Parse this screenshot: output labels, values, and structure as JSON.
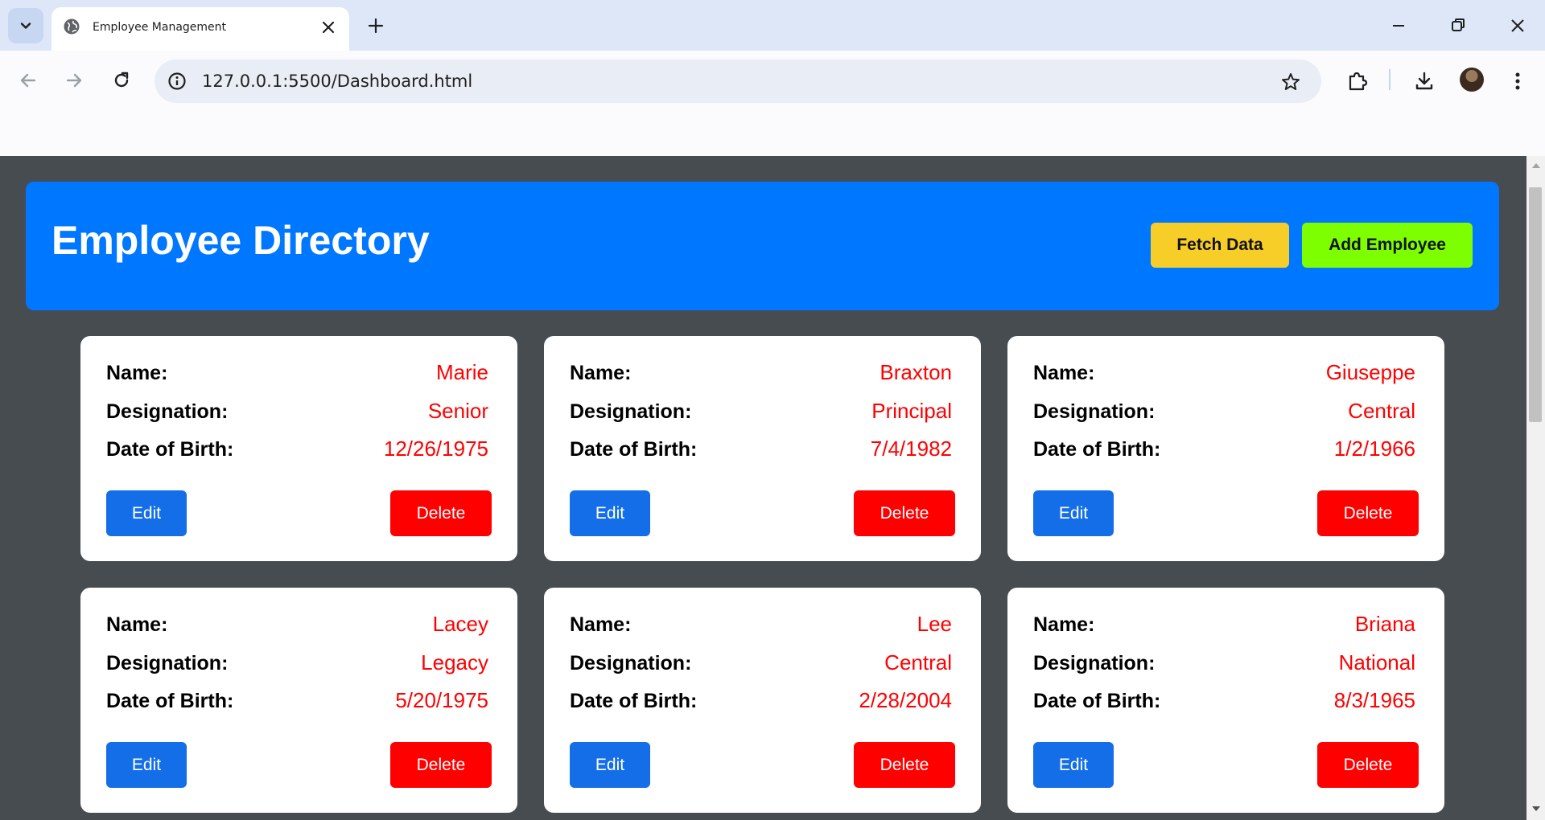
{
  "browser": {
    "tab_title": "Employee Management",
    "url": "127.0.0.1:5500/Dashboard.html"
  },
  "header": {
    "title": "Employee Directory",
    "fetch_label": "Fetch Data",
    "add_label": "Add Employee"
  },
  "labels": {
    "name": "Name:",
    "designation": "Designation:",
    "dob": "Date of Birth:",
    "edit": "Edit",
    "delete": "Delete"
  },
  "employees": [
    {
      "name": "Marie",
      "designation": "Senior",
      "dob": "12/26/1975"
    },
    {
      "name": "Braxton",
      "designation": "Principal",
      "dob": "7/4/1982"
    },
    {
      "name": "Giuseppe",
      "designation": "Central",
      "dob": "1/2/1966"
    },
    {
      "name": "Lacey",
      "designation": "Legacy",
      "dob": "5/20/1975"
    },
    {
      "name": "Lee",
      "designation": "Central",
      "dob": "2/28/2004"
    },
    {
      "name": "Briana",
      "designation": "National",
      "dob": "8/3/1965"
    }
  ],
  "colors": {
    "header_bg": "#0077ff",
    "fetch_btn": "#f7ce27",
    "add_btn": "#7dff00",
    "edit_btn": "#136ee8",
    "delete_btn": "#ff0000",
    "value_text": "#ff0000",
    "page_bg": "#474c51"
  }
}
